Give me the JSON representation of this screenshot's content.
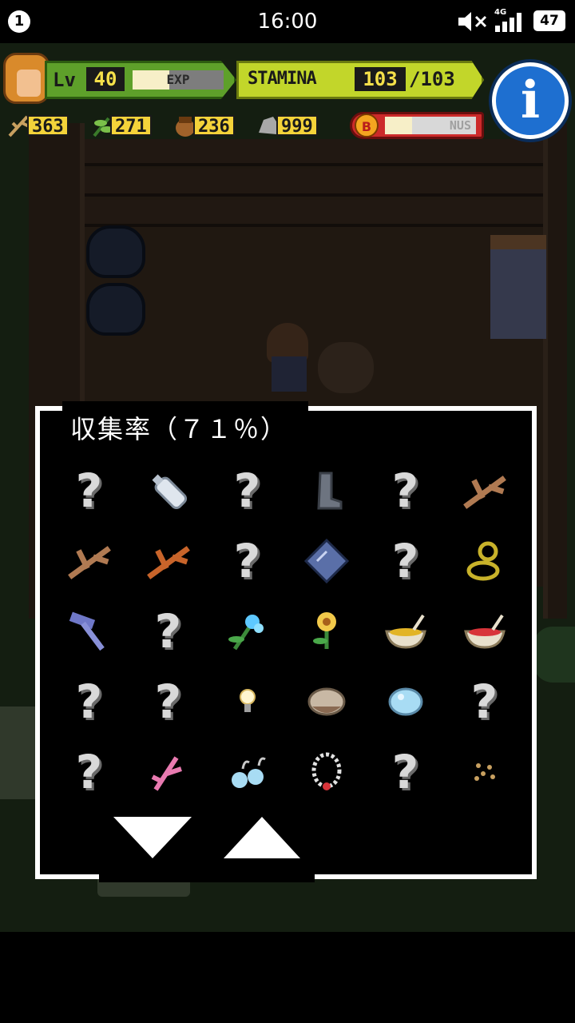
{
  "status_bar": {
    "notification_count": "1",
    "time": "16:00",
    "network": "4G",
    "battery": "47"
  },
  "hud": {
    "level_label": "Lv",
    "level": "40",
    "exp_label": "EXP",
    "exp_fraction": 0.4,
    "stamina_label": "STAMINA",
    "stamina_current": "103",
    "stamina_max": "/103",
    "resources": [
      {
        "icon": "branch-icon",
        "value": "363"
      },
      {
        "icon": "herb-icon",
        "value": "271"
      },
      {
        "icon": "nut-icon",
        "value": "236"
      },
      {
        "icon": "stone-icon",
        "value": "999"
      }
    ],
    "bonus_coin": "B",
    "bonus_label": "NUS",
    "bonus_fraction": 0.3
  },
  "collection": {
    "title": "収集率（７１％）",
    "cells": [
      [
        "unknown",
        "bottle",
        "unknown",
        "boot",
        "unknown",
        "twig"
      ],
      [
        "twig",
        "twig-orange",
        "unknown",
        "mirror",
        "unknown",
        "rope"
      ],
      [
        "hammer",
        "unknown",
        "blue-flower",
        "yellow-flower",
        "bowl-yellow",
        "bowl-red"
      ],
      [
        "unknown",
        "unknown",
        "light-bulb",
        "shell",
        "pearl",
        "unknown"
      ],
      [
        "unknown",
        "pink-twig",
        "earrings",
        "necklace",
        "unknown",
        "seeds"
      ]
    ],
    "unknown_glyph": "?"
  },
  "colors": {
    "accent_green": "#5ea02a",
    "stamina_yellow": "#c2d62a",
    "info_blue": "#1e6fd0",
    "bonus_red": "#cc2a2a"
  }
}
